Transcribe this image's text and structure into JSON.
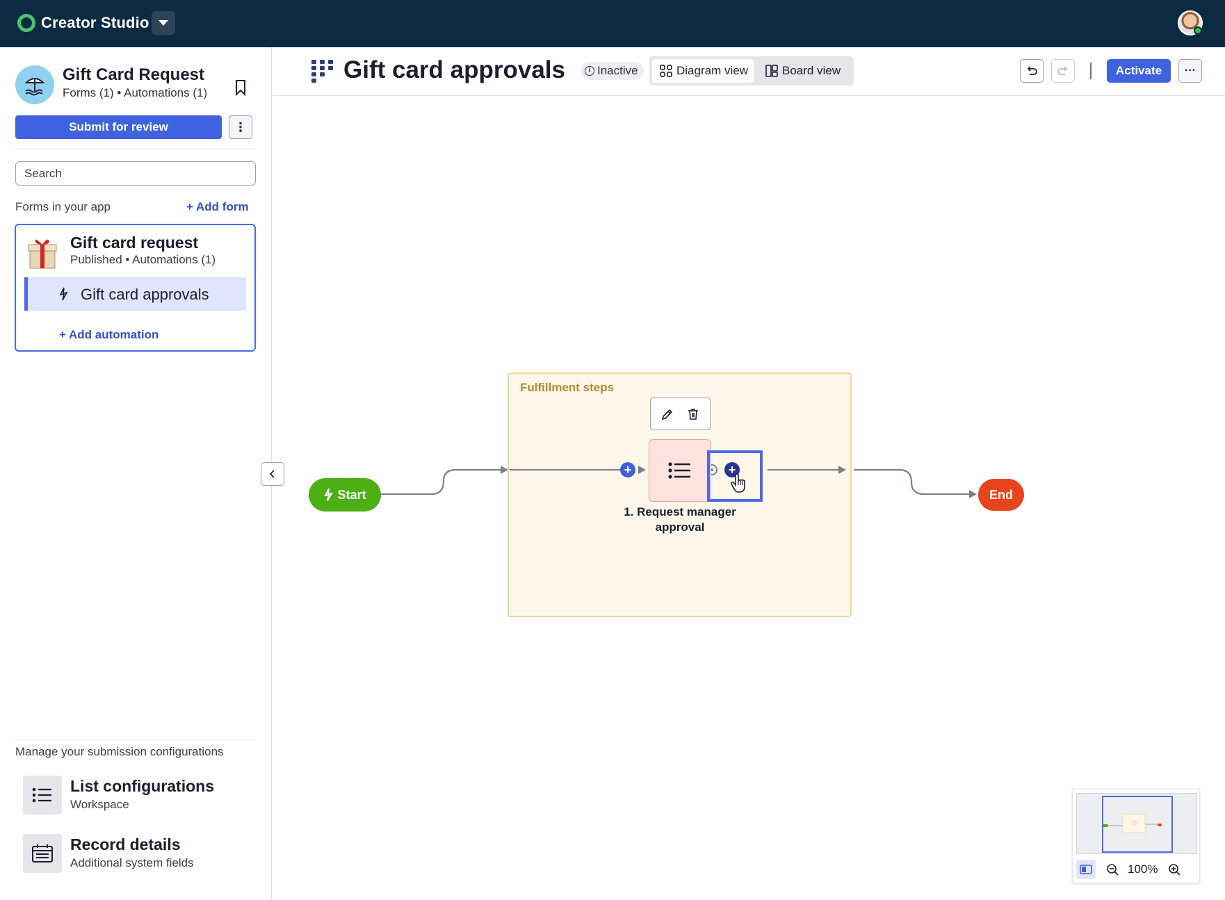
{
  "topbar": {
    "brand": "Creator Studio",
    "app_switcher_icon": "chevron-down-icon",
    "user_avatar_icon": "user-avatar"
  },
  "sidebar": {
    "app": {
      "title": "Gift Card Request",
      "subtitle": "Forms (1) • Automations (1)",
      "icon": "beach-umbrella-icon"
    },
    "submit_label": "Submit for review",
    "search_placeholder": "Search",
    "forms_label": "Forms in your app",
    "add_form_label": "+ Add form",
    "form_card": {
      "title": "Gift card request",
      "subtitle": "Published • Automations (1)",
      "icon": "gift-icon",
      "automation_label": "Gift card approvals",
      "add_automation_label": "+ Add automation"
    },
    "manage_label": "Manage your submission configurations",
    "configs": [
      {
        "title": "List configurations",
        "subtitle": "Workspace",
        "icon": "list-icon"
      },
      {
        "title": "Record details",
        "subtitle": "Additional system fields",
        "icon": "record-details-icon"
      }
    ]
  },
  "header": {
    "title": "Gift card approvals",
    "status": "Inactive",
    "views": [
      {
        "label": "Diagram view",
        "active": true
      },
      {
        "label": "Board view",
        "active": false
      }
    ],
    "activate_label": "Activate"
  },
  "canvas": {
    "group_label": "Fulfillment steps",
    "start_label": "Start",
    "end_label": "End",
    "step_label": "1. Request manager approval",
    "zoom": "100%"
  },
  "colors": {
    "topbar": "#0c2b43",
    "primary": "#3f63e0",
    "start": "#4caf14",
    "end": "#e8451c",
    "group_bg": "#fff8ea",
    "group_border": "#f2d79a"
  }
}
